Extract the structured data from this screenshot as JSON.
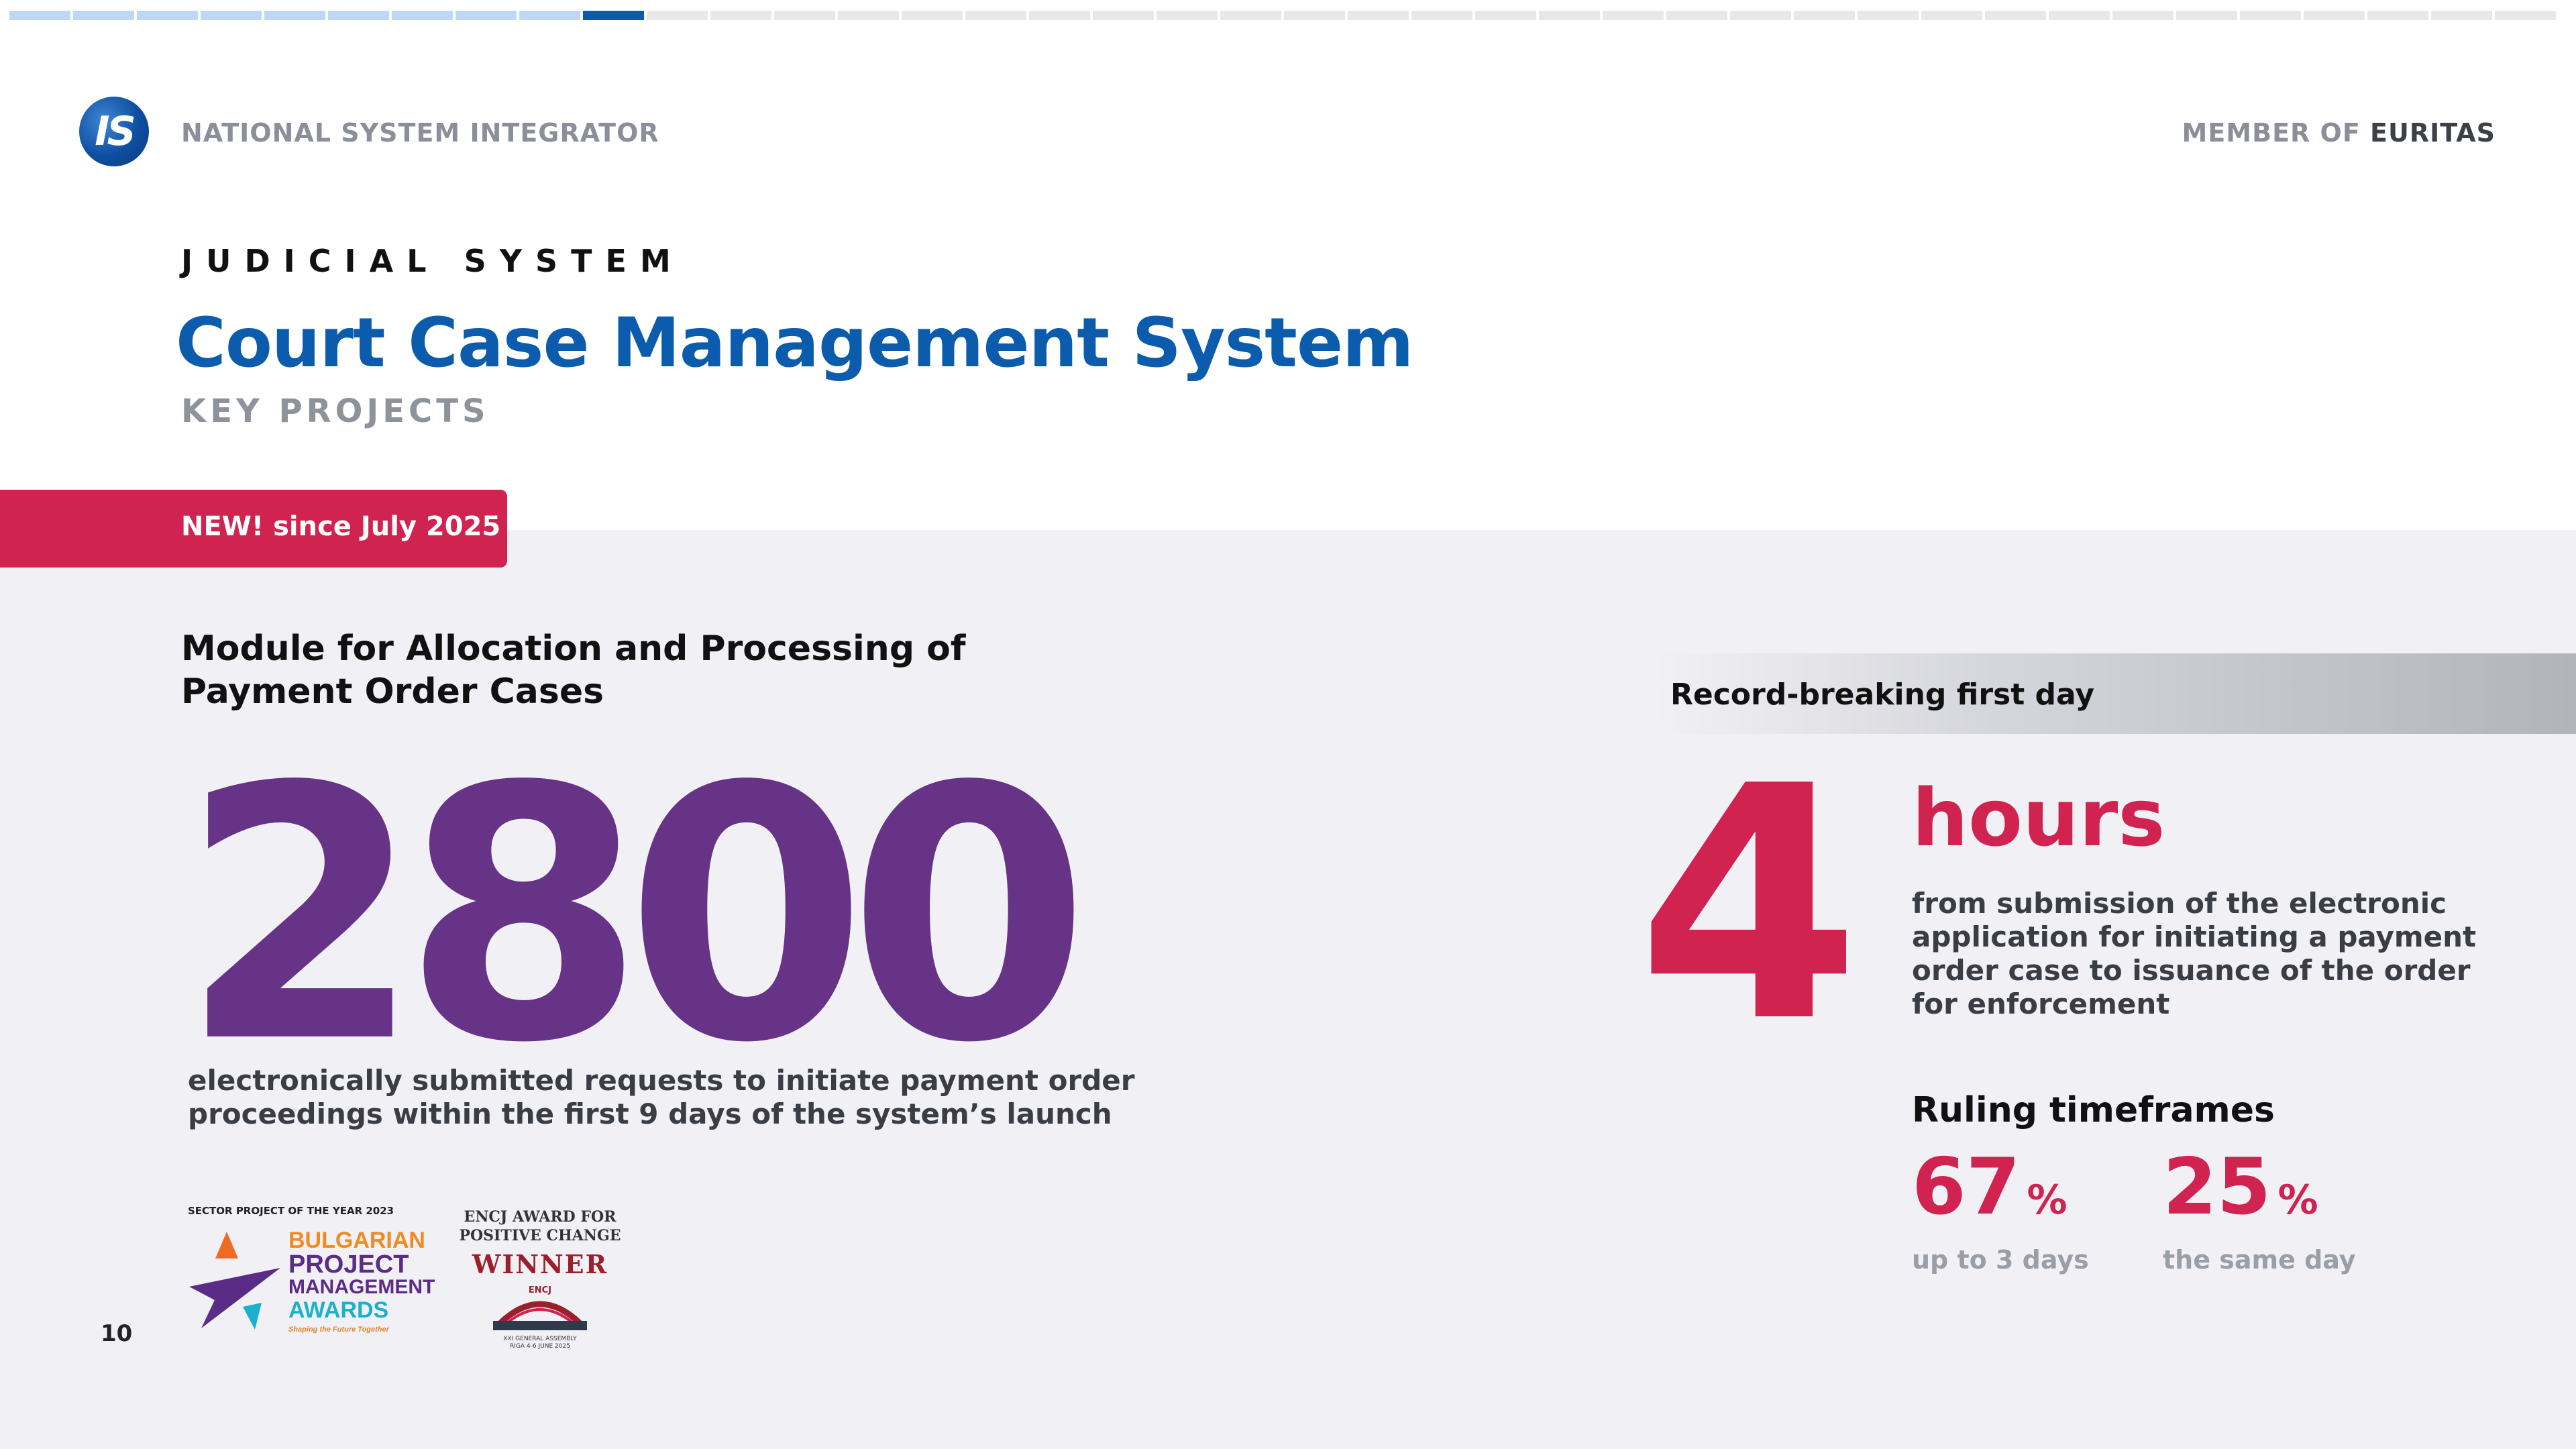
{
  "progress": {
    "total": 40,
    "completed": 9,
    "current": 10
  },
  "header": {
    "logo_text": "IS",
    "left_text": "NATIONAL SYSTEM INTEGRATOR",
    "right_prefix": "MEMBER OF",
    "right_strong": "EURITAS"
  },
  "hero": {
    "category": "JUDICIAL SYSTEM",
    "title": "Court Case Management System",
    "subtitle": "KEY PROJECTS"
  },
  "badge": {
    "text": "NEW! since July 2025",
    "color": "#d0234f"
  },
  "module": {
    "title": "Module for Allocation and Processing of Payment Order Cases",
    "big_number": "2800",
    "description": "electronically submitted requests to initiate payment order proceedings within the first 9 days of the system’s launch"
  },
  "awards": {
    "pm_award": {
      "caption": "SECTOR PROJECT OF THE YEAR 2023",
      "line1": "BULGARIAN",
      "line2": "PROJECT",
      "line3": "MANAGEMENT",
      "line4": "AWARDS",
      "tagline": "Shaping the Future Together"
    },
    "encj_award": {
      "caption_line1": "ENCJ AWARD FOR",
      "caption_line2": "POSITIVE CHANGE",
      "winner": "WINNER",
      "logo_text": "ENCJ",
      "footer_line1": "XXI GENERAL ASSEMBLY",
      "footer_line2": "RIGA 4-6 JUNE 2025"
    }
  },
  "page_number": "10",
  "record": {
    "label": "Record-breaking first day",
    "big_number": "4",
    "unit": "hours",
    "description": "from submission of the electronic application for initiating a payment order case to issuance of the order for enforcement"
  },
  "ruling": {
    "title": "Ruling timeframes",
    "stats": [
      {
        "value": "67",
        "unit": "%",
        "label": "up to 3 days"
      },
      {
        "value": "25",
        "unit": "%",
        "label": "the same day"
      }
    ]
  },
  "colors": {
    "brand_blue": "#0b5cad",
    "accent_red": "#d0234f",
    "accent_purple": "#663387",
    "panel_gray": "#f1f0f5"
  }
}
